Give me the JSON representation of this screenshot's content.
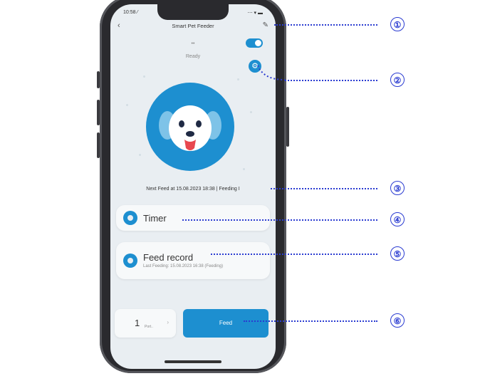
{
  "status_bar": {
    "time": "10:58 ⁄",
    "signals": "⋯ ▾ ▬"
  },
  "header": {
    "back_label": "‹",
    "title": "Smart Pet Feeder",
    "edit_label": "✎"
  },
  "device": {
    "line1": "••",
    "line2": "Ready"
  },
  "next_feed_text": "Next Feed at 15.08.2023 18:38 | Feeding I",
  "cards": {
    "timer_label": "Timer",
    "feed_record_label": "Feed record",
    "feed_record_sub": "Last Feeding: 15.08.2023 16:38 (Feeding)"
  },
  "portion": {
    "value": "1",
    "unit": "Port..",
    "chevron": "›"
  },
  "feed_button_label": "Feed",
  "callouts": [
    "①",
    "②",
    "③",
    "④",
    "⑤",
    "⑥"
  ],
  "colors": {
    "accent": "#1d8fd0",
    "callout": "#2a3bd1"
  }
}
